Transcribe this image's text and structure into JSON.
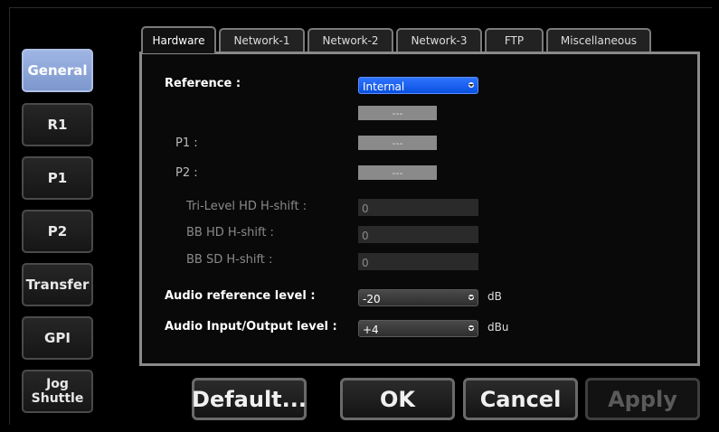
{
  "nav": [
    {
      "label": "General",
      "active": true
    },
    {
      "label": "R1"
    },
    {
      "label": "P1"
    },
    {
      "label": "P2"
    },
    {
      "label": "Transfer"
    },
    {
      "label": "GPI"
    },
    {
      "label": "Jog Shuttle"
    }
  ],
  "tabs": [
    "Hardware",
    "Network-1",
    "Network-2",
    "Network-3",
    "FTP",
    "Miscellaneous"
  ],
  "form": {
    "reference_label": "Reference :",
    "reference_value": "Internal",
    "ref_status": "---",
    "p1_label": "P1 :",
    "p1_value": "---",
    "p2_label": "P2 :",
    "p2_value": "---",
    "tri_level_label": "Tri-Level HD H-shift :",
    "tri_level_value": "0",
    "bb_hd_label": "BB HD H-shift :",
    "bb_hd_value": "0",
    "bb_sd_label": "BB SD H-shift :",
    "bb_sd_value": "0",
    "audio_ref_label": "Audio reference level :",
    "audio_ref_value": "-20",
    "audio_ref_unit": "dB",
    "audio_io_label": "Audio Input/Output level :",
    "audio_io_value": "+4",
    "audio_io_unit": "dBu"
  },
  "buttons": {
    "default": "Default...",
    "ok": "OK",
    "cancel": "Cancel",
    "apply": "Apply"
  },
  "colors": {
    "active_nav": "#8aa3d8",
    "dropdown_selected": "#1a5cff",
    "field_grey": "#8a8a8a"
  }
}
